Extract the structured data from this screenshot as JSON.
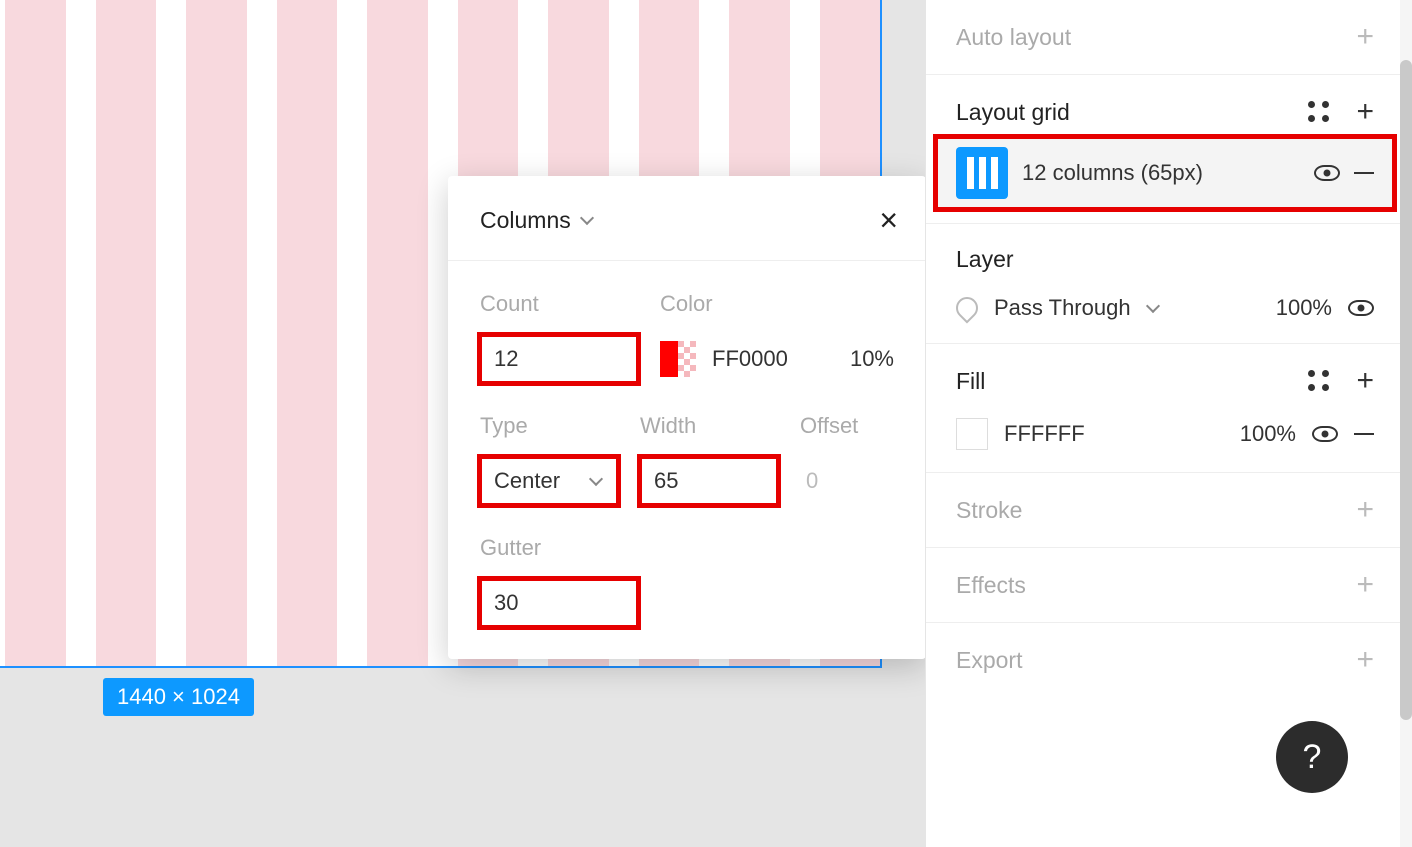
{
  "canvas": {
    "frame_dimensions": "1440 × 1024"
  },
  "popup": {
    "title": "Columns",
    "fields": {
      "count_label": "Count",
      "count_value": "12",
      "color_label": "Color",
      "color_hex": "FF0000",
      "color_opacity": "10%",
      "type_label": "Type",
      "type_value": "Center",
      "width_label": "Width",
      "width_value": "65",
      "offset_label": "Offset",
      "offset_value": "0",
      "gutter_label": "Gutter",
      "gutter_value": "30"
    }
  },
  "sidebar": {
    "auto_layout": {
      "title": "Auto layout"
    },
    "layout_grid": {
      "title": "Layout grid",
      "row_label": "12 columns (65px)"
    },
    "layer": {
      "title": "Layer",
      "mode": "Pass Through",
      "opacity": "100%"
    },
    "fill": {
      "title": "Fill",
      "hex": "FFFFFF",
      "opacity": "100%"
    },
    "stroke": {
      "title": "Stroke"
    },
    "effects": {
      "title": "Effects"
    },
    "export": {
      "title": "Export"
    }
  },
  "help": {
    "label": "?"
  }
}
